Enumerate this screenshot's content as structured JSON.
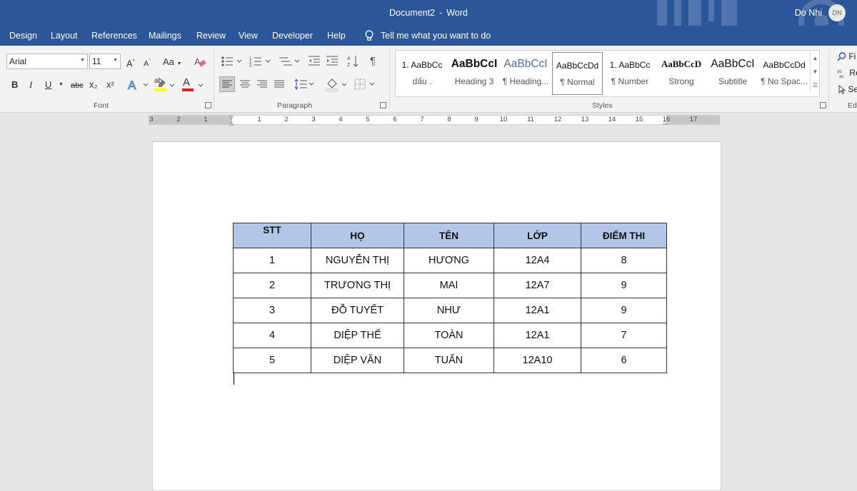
{
  "titlebar": {
    "document": "Document2",
    "separator": "-",
    "app": "Word",
    "user_name": "Do Nhi",
    "user_initials": "DN"
  },
  "menu": {
    "items": [
      "Design",
      "Layout",
      "References",
      "Mailings",
      "Review",
      "View",
      "Developer",
      "Help"
    ],
    "tell_me": "Tell me what you want to do"
  },
  "ribbon": {
    "font": {
      "name": "Arial",
      "size": "11",
      "label": "Font",
      "case_label": "Aa",
      "grow_label": "A",
      "shrink_label": "A",
      "bold": "B",
      "italic": "I",
      "underline": "U",
      "strike": "abc",
      "subscript": "x₂",
      "superscript": "x²",
      "color_letter": "A",
      "highlight_letters": "ab"
    },
    "paragraph": {
      "label": "Paragraph",
      "pilcrow": "¶"
    },
    "styles": {
      "label": "Styles",
      "items": [
        {
          "preview": "1. AaBbCc",
          "name": "dấu ."
        },
        {
          "preview": "AaBbCcI",
          "name": "Heading 3"
        },
        {
          "preview": "AaBbCcI",
          "name": "¶ Heading..."
        },
        {
          "preview": "AaBbCcDd",
          "name": "¶ Normal"
        },
        {
          "preview": "1. AaBbCc",
          "name": "¶ Number"
        },
        {
          "preview": "AaBbCcD",
          "name": "Strong"
        },
        {
          "preview": "AaBbCcI",
          "name": "Subtitle"
        },
        {
          "preview": "AaBbCcDd",
          "name": "¶ No Spac..."
        }
      ]
    },
    "editing": {
      "label": "Ed",
      "find": "Fi",
      "replace": "Re",
      "select": "Se"
    }
  },
  "ruler": {
    "labels": [
      "3",
      "2",
      "1",
      "1",
      "2",
      "3",
      "4",
      "5",
      "6",
      "7",
      "8",
      "9",
      "10",
      "11",
      "12",
      "13",
      "14",
      "15",
      "16",
      "17"
    ]
  },
  "table": {
    "headers": [
      "STT",
      "HỌ",
      "TÊN",
      "LỚP",
      "ĐIỂM THI"
    ],
    "rows": [
      [
        "1",
        "NGUYỄN THỊ",
        "HƯƠNG",
        "12A4",
        "8"
      ],
      [
        "2",
        "TRƯƠNG THỊ",
        "MAI",
        "12A7",
        "9"
      ],
      [
        "3",
        "ĐỖ TUYẾT",
        "NHƯ",
        "12A1",
        "9"
      ],
      [
        "4",
        "DIỆP THẾ",
        "TOÀN",
        "12A1",
        "7"
      ],
      [
        "5",
        "DIỆP VĂN",
        "TUẤN",
        "12A10",
        "6"
      ]
    ]
  },
  "colors": {
    "accent": "#2b579a",
    "header_fill": "#b4c6e7",
    "highlight": "#ffff00",
    "font_color": "#e02020"
  }
}
